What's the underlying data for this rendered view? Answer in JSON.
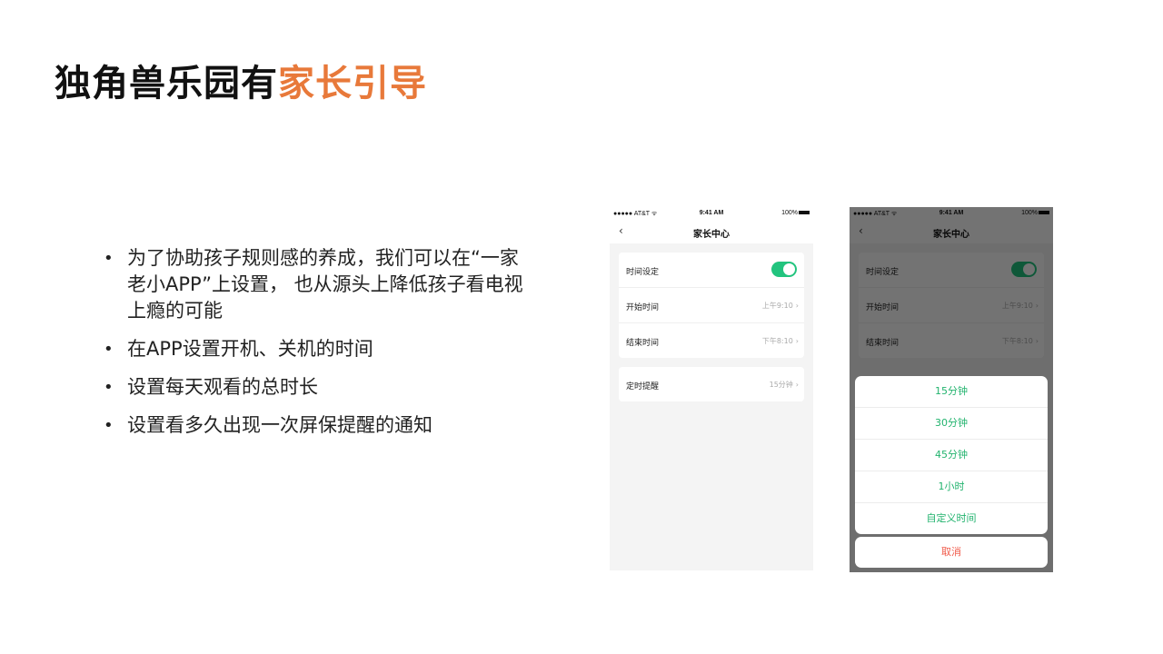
{
  "slide": {
    "title_main": "独角兽乐园有",
    "title_accent": "家长引导",
    "accent_color": "#e8793a",
    "bullets": [
      "为了协助孩子规则感的养成，我们可以在“一家老小APP”上设置，   也从源头上降低孩子看电视上瘾的可能",
      "在APP设置开机、关机的时间",
      "设置每天观看的总时长",
      "设置看多久出现一次屏保提醒的通知"
    ]
  },
  "phone": {
    "status": {
      "carrier": "●●●●● AT&T ᯤ",
      "time": "9:41 AM",
      "battery": "100%"
    },
    "nav": {
      "back_icon": "chevron-left-icon",
      "back": "‹",
      "title": "家长中心"
    },
    "settings": {
      "time_setting_label": "时间设定",
      "toggle_on": true,
      "start_label": "开始时间",
      "start_value": "上午9:10",
      "end_label": "结束时间",
      "end_value": "下午8:10",
      "reminder_label": "定时提醒",
      "reminder_value": "15分钟",
      "chevron": "›"
    },
    "toggle_color": "#22c47e"
  },
  "picker": {
    "options": [
      "15分钟",
      "30分钟",
      "45分钟",
      "1小时",
      "自定义时间"
    ],
    "cancel": "取消",
    "option_color": "#22b36e",
    "cancel_color": "#f05a4a"
  }
}
